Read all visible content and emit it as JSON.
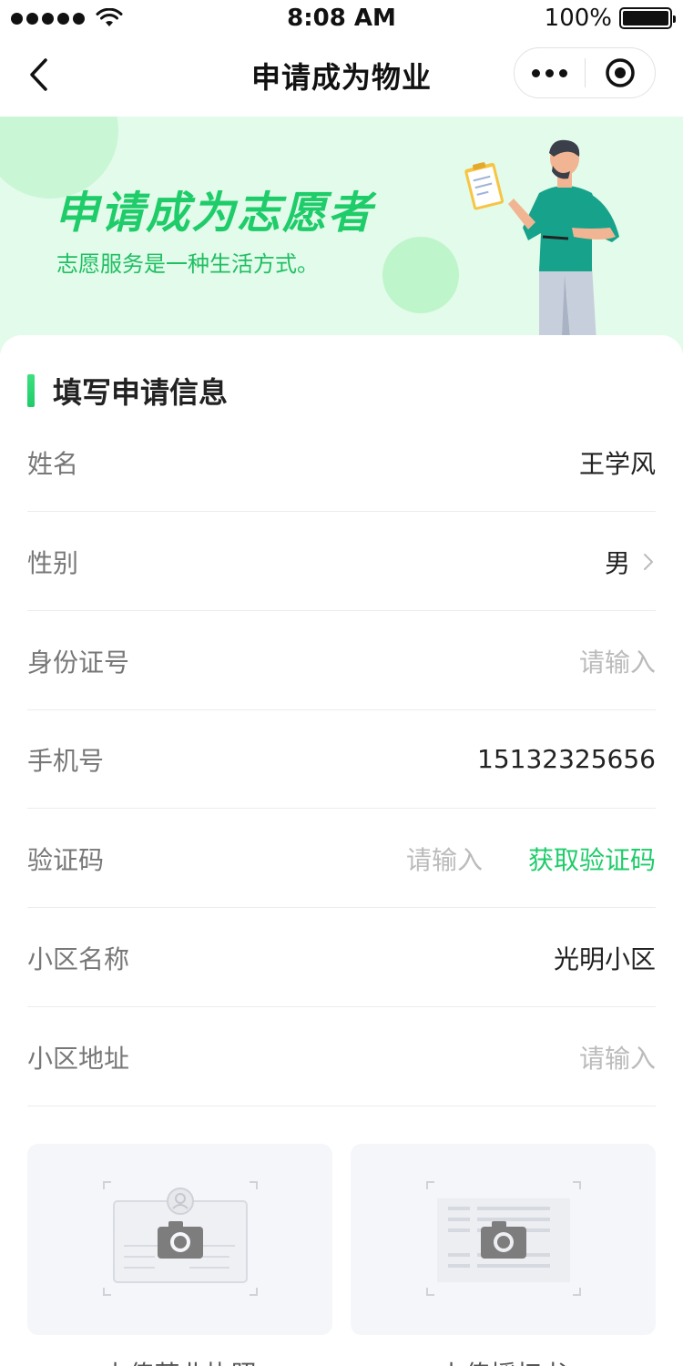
{
  "status_bar": {
    "time": "8:08 AM",
    "battery": "100%"
  },
  "nav": {
    "title": "申请成为物业"
  },
  "banner": {
    "title": "申请成为志愿者",
    "subtitle": "志愿服务是一种生活方式。"
  },
  "section": {
    "title": "填写申请信息"
  },
  "form": {
    "name": {
      "label": "姓名",
      "value": "王学风"
    },
    "gender": {
      "label": "性别",
      "value": "男"
    },
    "id_number": {
      "label": "身份证号",
      "placeholder": "请输入"
    },
    "phone": {
      "label": "手机号",
      "value": "15132325656"
    },
    "verify_code": {
      "label": "验证码",
      "placeholder": "请输入",
      "action": "获取验证码"
    },
    "community_name": {
      "label": "小区名称",
      "value": "光明小区"
    },
    "community_address": {
      "label": "小区地址",
      "placeholder": "请输入"
    }
  },
  "uploads": {
    "license_caption": "上传营业执照",
    "id_caption": "上传授权书"
  },
  "colors": {
    "accent": "#1fcc6a",
    "banner_bg": "#e3fbea"
  }
}
